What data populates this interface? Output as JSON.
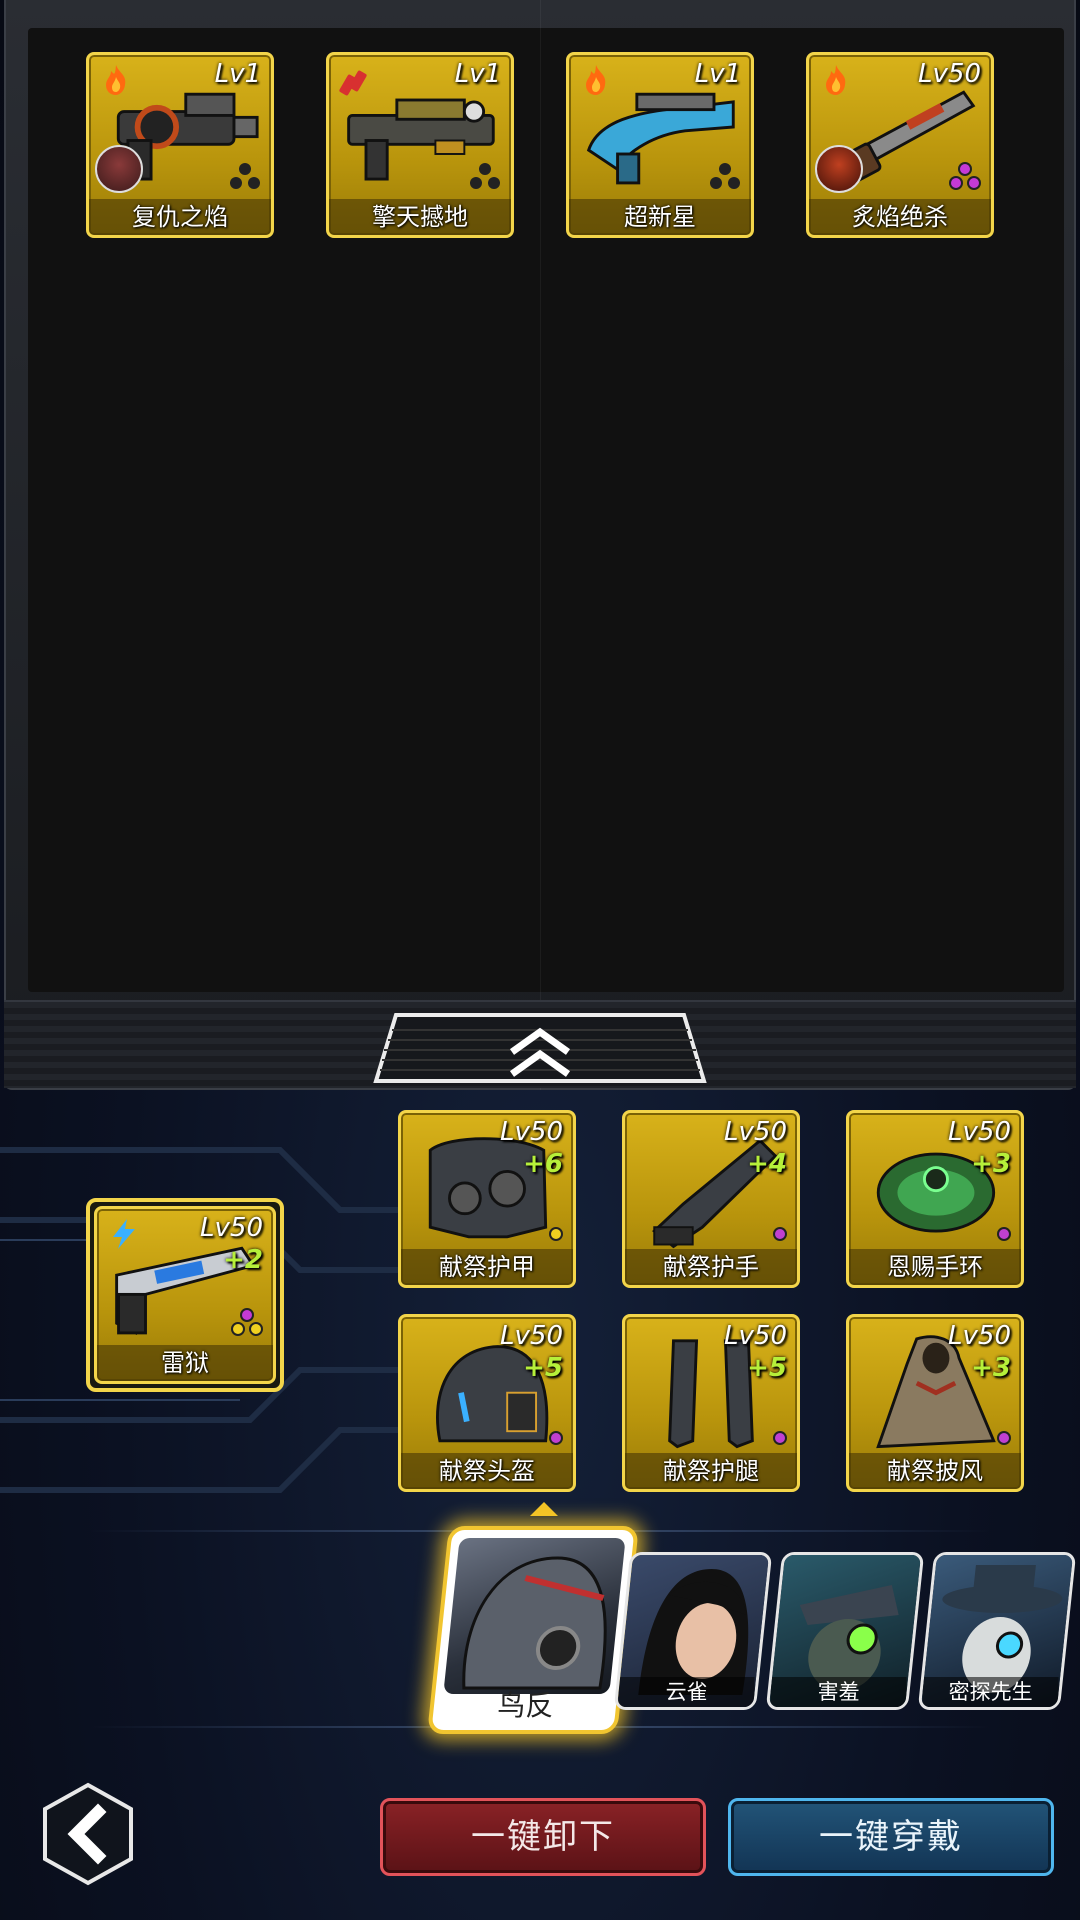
{
  "inventory": {
    "items": [
      {
        "level": "Lv1",
        "name": "复仇之焰",
        "type_icon": "fire-icon",
        "quality_dots": "three-black",
        "has_avatar": true
      },
      {
        "level": "Lv1",
        "name": "擎天撼地",
        "type_icon": "dynamite-icon",
        "quality_dots": "three-black",
        "has_avatar": false
      },
      {
        "level": "Lv1",
        "name": "超新星",
        "type_icon": "fire-icon",
        "quality_dots": "three-black",
        "has_avatar": false
      },
      {
        "level": "Lv50",
        "name": "炙焰绝杀",
        "type_icon": "fire-icon",
        "quality_dots": "three-purple",
        "has_avatar": true
      }
    ]
  },
  "equipped": {
    "weapon": {
      "level": "Lv50",
      "plus": "+2",
      "name": "雷狱",
      "type_icon": "lightning-icon",
      "quality_dots": "three-yellow"
    },
    "gear": [
      {
        "level": "Lv50",
        "plus": "+6",
        "name": "献祭护甲",
        "dot_color": "#f0d020"
      },
      {
        "level": "Lv50",
        "plus": "+4",
        "name": "献祭护手",
        "dot_color": "#c040d0"
      },
      {
        "level": "Lv50",
        "plus": "+3",
        "name": "恩赐手环",
        "dot_color": "#c040d0"
      },
      {
        "level": "Lv50",
        "plus": "+5",
        "name": "献祭头盔",
        "dot_color": "#c040d0"
      },
      {
        "level": "Lv50",
        "plus": "+5",
        "name": "献祭护腿",
        "dot_color": "#c040d0"
      },
      {
        "level": "Lv50",
        "plus": "+3",
        "name": "献祭披风",
        "dot_color": "#c040d0"
      }
    ]
  },
  "heroes": {
    "selected": "鸟反",
    "others": [
      "云雀",
      "害羞",
      "密探先生"
    ]
  },
  "buttons": {
    "unequip_all": "一键卸下",
    "equip_all": "一键穿戴"
  },
  "colors": {
    "card_gold": "#d8b21a",
    "plus_green": "#b6f03a",
    "unequip_red": "#8a2226",
    "equip_blue": "#225478",
    "highlight_gold": "#f1c530"
  }
}
